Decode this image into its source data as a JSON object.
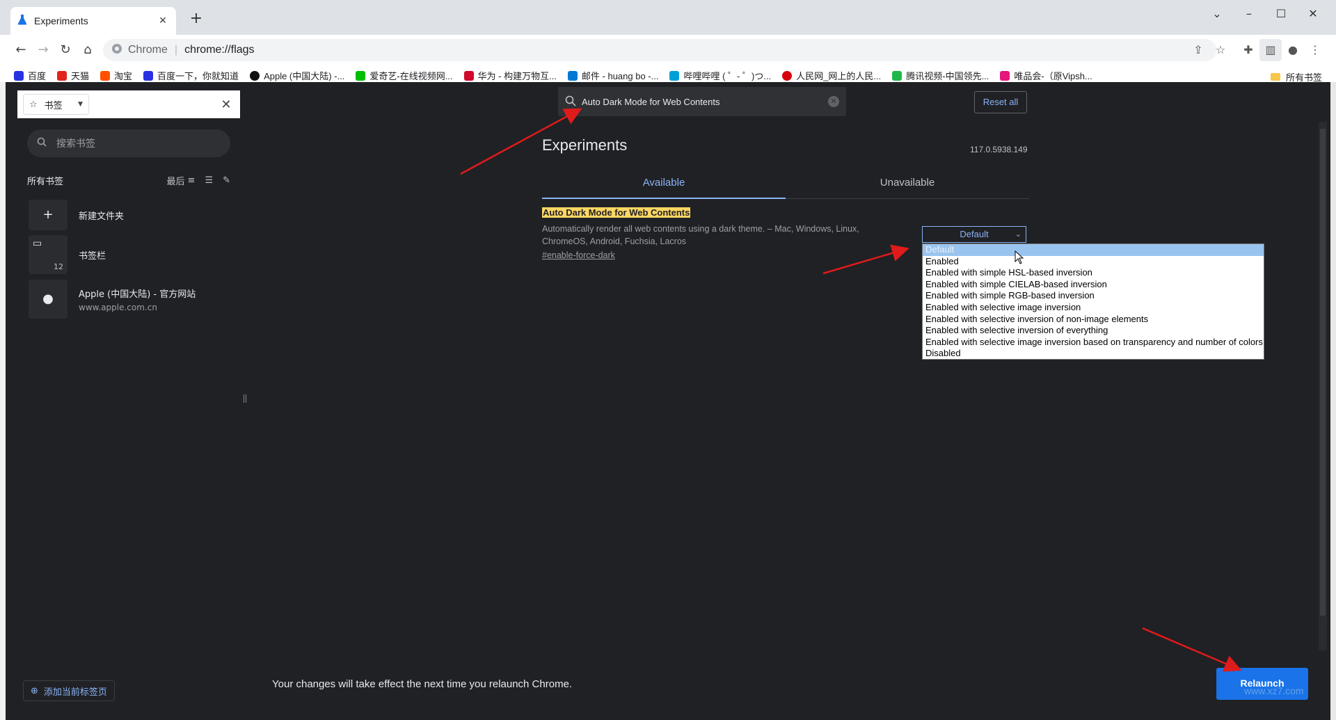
{
  "browser": {
    "tab_title": "Experiments",
    "omnibox_site": "Chrome",
    "omnibox_url": "chrome://flags"
  },
  "bookmarks_bar": {
    "items": [
      {
        "label": "百度",
        "color": "#2932e1"
      },
      {
        "label": "天猫",
        "color": "#e1251b"
      },
      {
        "label": "淘宝",
        "color": "#ff5000"
      },
      {
        "label": "百度一下，你就知道",
        "color": "#2932e1"
      },
      {
        "label": "Apple (中国大陆) -...",
        "color": "#111111"
      },
      {
        "label": "爱奇艺-在线视频网...",
        "color": "#00be06"
      },
      {
        "label": "华为 - 构建万物互...",
        "color": "#cf0a2c"
      },
      {
        "label": "邮件 - huang bo -...",
        "color": "#0078d4"
      },
      {
        "label": "哔哩哔哩 ( ゜- ゜)つ...",
        "color": "#00a1d6"
      },
      {
        "label": "人民网_网上的人民...",
        "color": "#d7000f"
      },
      {
        "label": "腾讯视频-中国领先...",
        "color": "#20b74a"
      },
      {
        "label": "唯品会-（原Vipsh...",
        "color": "#e5177b"
      }
    ],
    "all_bookmarks": "所有书签"
  },
  "side_panel": {
    "selector_label": "书签",
    "search_placeholder": "搜索书签",
    "all_bookmarks": "所有书签",
    "sort_label": "最后",
    "items": [
      {
        "title": "新建文件夹",
        "sub": ""
      },
      {
        "title": "书签栏",
        "sub": "",
        "count": "12"
      },
      {
        "title": "Apple (中国大陆) - 官方网站",
        "sub": "www.apple.com.cn"
      }
    ],
    "add_current_tab": "添加当前标签页"
  },
  "flags_page": {
    "search_value": "Auto Dark Mode for Web Contents",
    "reset_all": "Reset all",
    "title": "Experiments",
    "version": "117.0.5938.149",
    "tabs": [
      "Available",
      "Unavailable"
    ],
    "flag": {
      "name": "Auto Dark Mode for Web Contents",
      "description": "Automatically render all web contents using a dark theme. – Mac, Windows, Linux, ChromeOS, Android, Fuchsia, Lacros",
      "link": "#enable-force-dark",
      "selected": "Default"
    },
    "dropdown_options": [
      "Default",
      "Enabled",
      "Enabled with simple HSL-based inversion",
      "Enabled with simple CIELAB-based inversion",
      "Enabled with simple RGB-based inversion",
      "Enabled with selective image inversion",
      "Enabled with selective inversion of non-image elements",
      "Enabled with selective inversion of everything",
      "Enabled with selective image inversion based on transparency and number of colors",
      "Disabled"
    ],
    "relaunch_message": "Your changes will take effect the next time you relaunch Chrome.",
    "relaunch_button": "Relaunch"
  },
  "watermark": "www.xz7.com",
  "colors": {
    "accent": "#8ab4f8",
    "highlight": "#fdd663",
    "relaunch": "#1a73e8",
    "annotation_arrow": "#e01b1b"
  }
}
